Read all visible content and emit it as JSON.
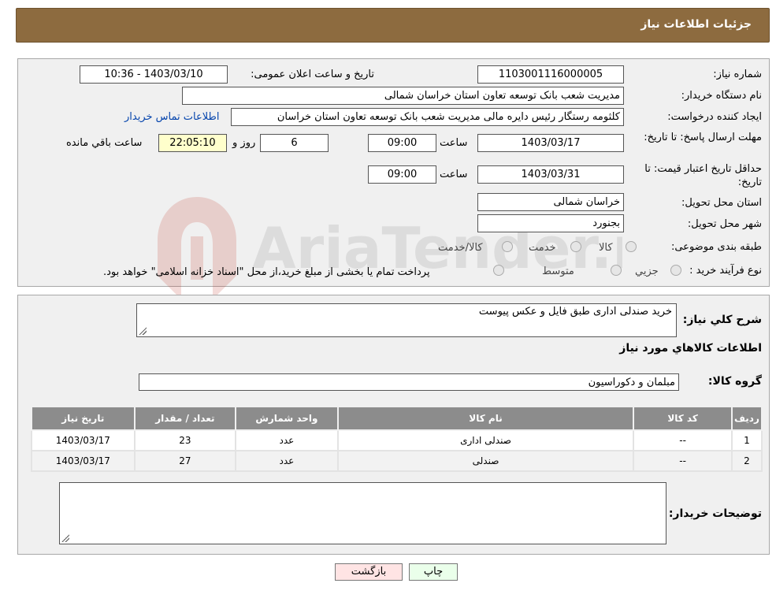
{
  "header": {
    "title": "جزئیات اطلاعات نیاز"
  },
  "details": {
    "need_number_label": "شماره نیاز:",
    "need_number": "1103001116000005",
    "announce_label": "تاریخ و ساعت اعلان عمومی:",
    "announce_value": "1403/03/10 - 10:36",
    "buyer_org_label": "نام دستگاه خریدار:",
    "buyer_org": "مدیریت شعب بانک توسعه تعاون استان خراسان شمالی",
    "creator_label": "ایجاد کننده درخواست:",
    "creator": "کلثومه رستگار رئیس دایره مالی مدیریت شعب بانک توسعه تعاون استان خراسان",
    "contact_link": "اطلاعات تماس خریدار",
    "deadline_label": "مهلت ارسال پاسخ: تا تاریخ:",
    "deadline_date": "1403/03/17",
    "time_label": "ساعت",
    "deadline_time": "09:00",
    "days_value": "6",
    "days_label": "روز و",
    "remaining_time": "22:05:10",
    "remaining_label": "ساعت باقي مانده",
    "validity_label": "حداقل تاریخ اعتبار قیمت: تا تاریخ:",
    "validity_date": "1403/03/31",
    "validity_time": "09:00",
    "province_label": "استان محل تحویل:",
    "province": "خراسان شمالی",
    "city_label": "شهر محل تحویل:",
    "city": "بجنورد",
    "category_label": "طبقه بندی موضوعی:",
    "category_options": [
      "کالا",
      "خدمت",
      "کالا/خدمت"
    ],
    "process_label": "نوع فرآیند خرید :",
    "process_options": [
      "جزیي",
      "متوسط"
    ],
    "process_note": "پرداخت تمام یا بخشی از مبلغ خرید،از محل \"اسناد خزانه اسلامی\" خواهد بود."
  },
  "summary": {
    "description_label": "شرح کلي نياز:",
    "description": "خرید صندلی اداری طبق فایل و عکس پیوست",
    "goods_info_title": "اطلاعات کالاهاي مورد نياز",
    "group_label": "گروه کالا:",
    "group_value": "مبلمان و دکوراسیون",
    "table": {
      "headers": [
        "رديف",
        "کد کالا",
        "نام کالا",
        "واحد شمارش",
        "تعداد / مقدار",
        "تاريخ نياز"
      ],
      "rows": [
        [
          "1",
          "--",
          "صندلی اداری",
          "عدد",
          "23",
          "1403/03/17"
        ],
        [
          "2",
          "--",
          "صندلی",
          "عدد",
          "27",
          "1403/03/17"
        ]
      ]
    },
    "buyer_notes_label": "توضيحات خريدار:",
    "buyer_notes": ""
  },
  "buttons": {
    "print": "چاپ",
    "back": "بازگشت"
  },
  "watermark": {
    "text": "AriaTender.neT"
  },
  "colors": {
    "header": "#8d6b3f",
    "back_button": "#ffe4e4",
    "print_button": "#eaffea",
    "link": "#0645ad"
  }
}
